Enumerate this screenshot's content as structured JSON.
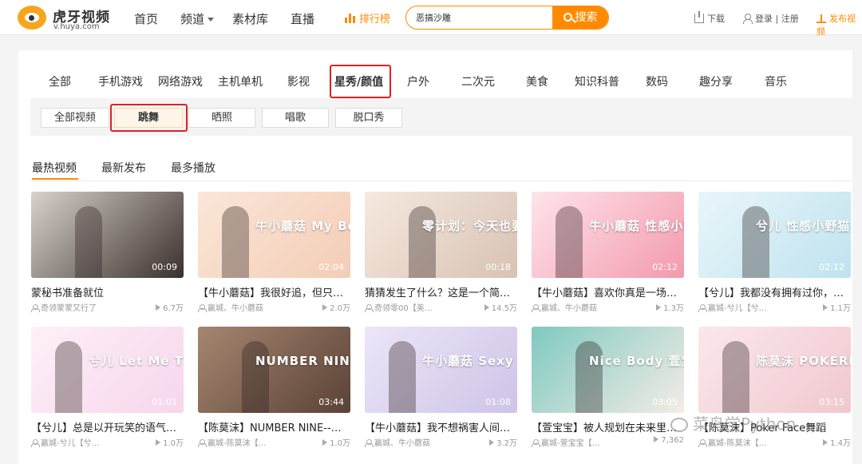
{
  "header": {
    "logo_title": "虎牙视频",
    "logo_sub": "v.huya.com",
    "nav": [
      {
        "label": "首页",
        "caret": false
      },
      {
        "label": "频道",
        "caret": true
      },
      {
        "label": "素材库",
        "caret": false
      },
      {
        "label": "直播",
        "caret": false
      }
    ],
    "rank_label": "排行榜",
    "search_value": "恶搞沙雕",
    "search_button": "搜索",
    "download_label": "下载",
    "login_label": "登录 | 注册",
    "upload_label": "发布视频"
  },
  "categories": [
    "全部",
    "手机游戏",
    "网络游戏",
    "主机单机",
    "影视",
    "星秀/颜值",
    "户外",
    "二次元",
    "美食",
    "知识科普",
    "数码",
    "趣分享",
    "音乐"
  ],
  "active_category": "星秀/颜值",
  "subcategories": [
    "全部视频",
    "跳舞",
    "晒照",
    "唱歌",
    "脱口秀"
  ],
  "active_subcategory": "跳舞",
  "sort_tabs": [
    "最热视频",
    "最新发布",
    "最多播放"
  ],
  "active_sort": "最热视频",
  "videos": [
    {
      "title": "蒙秘书准备就位",
      "author": "奇领蒙蒙又行了",
      "views": "6.7万",
      "duration": "00:09",
      "thumb_text": "",
      "bg": "#3a302c",
      "accent": "#d9d2cc"
    },
    {
      "title": "【牛小蘑菇】我很好追，但只限…",
      "author": "赢城、牛小蘑菇",
      "views": "2.0万",
      "duration": "02:04",
      "thumb_text": "牛小蘑菇 My Boo",
      "bg": "#f3cdb6",
      "accent": "#fbe6d8"
    },
    {
      "title": "猜猜发生了什么？这是一个简短…",
      "author": "奇领零00【美…",
      "views": "14.5万",
      "duration": "00:18",
      "thumb_text": "零计划：今天也要甜甜的",
      "bg": "#d8c2b4",
      "accent": "#f6e9df"
    },
    {
      "title": "【牛小蘑菇】喜欢你真是一场不…",
      "author": "赢城、牛小蘑菇",
      "views": "1.3万",
      "duration": "02:12",
      "thumb_text": "牛小蘑菇 性感小野猫",
      "bg": "#f29aae",
      "accent": "#ffe4ea"
    },
    {
      "title": "【兮儿】我都没有拥有过你，又…",
      "author": "赢城-兮儿【兮…",
      "views": "1.1万",
      "duration": "02:12",
      "thumb_text": "兮儿 性感小野猫",
      "bg": "#bfe3ef",
      "accent": "#e9f6fa"
    },
    {
      "title": "【兮儿】总是以开玩笑的语气和…",
      "author": "赢城-兮儿【兮…",
      "views": "1.0万",
      "duration": "01:01",
      "thumb_text": "兮儿 Let Me Think About It",
      "bg": "#f7d6ec",
      "accent": "#fdf0f8"
    },
    {
      "title": "【陈莫沫】NUMBER NINE--舞蹈",
      "author": "赢城-陈莫沫【…",
      "views": "1.0万",
      "duration": "03:44",
      "thumb_text": "NUMBER NINE 陈莫沫",
      "bg": "#5a4236",
      "accent": "#a68670"
    },
    {
      "title": "【牛小蘑菇】我不想祸害人间，…",
      "author": "赢城、牛小蘑菇",
      "views": "3.2万",
      "duration": "01:08",
      "thumb_text": "牛小蘑菇 Sexy Papi",
      "bg": "#cfc3e8",
      "accent": "#ece6f7"
    },
    {
      "title": "【萱宝宝】被人规划在未来里…",
      "author": "赢城-萱宝宝【…",
      "views": "7,362",
      "duration": "03:05",
      "thumb_text": "Nice Body 萱宝宝",
      "bg": "#f4ece6",
      "accent": "#7fc9c0"
    },
    {
      "title": "【陈莫沫】Poker Face舞蹈",
      "author": "赢城-陈莫沫【…",
      "views": "1.4万",
      "duration": "03:15",
      "thumb_text": "陈莫沫 POKERFACE",
      "bg": "#f0c8cf",
      "accent": "#fbe8eb"
    }
  ],
  "watermark": "菜鸟学Python"
}
